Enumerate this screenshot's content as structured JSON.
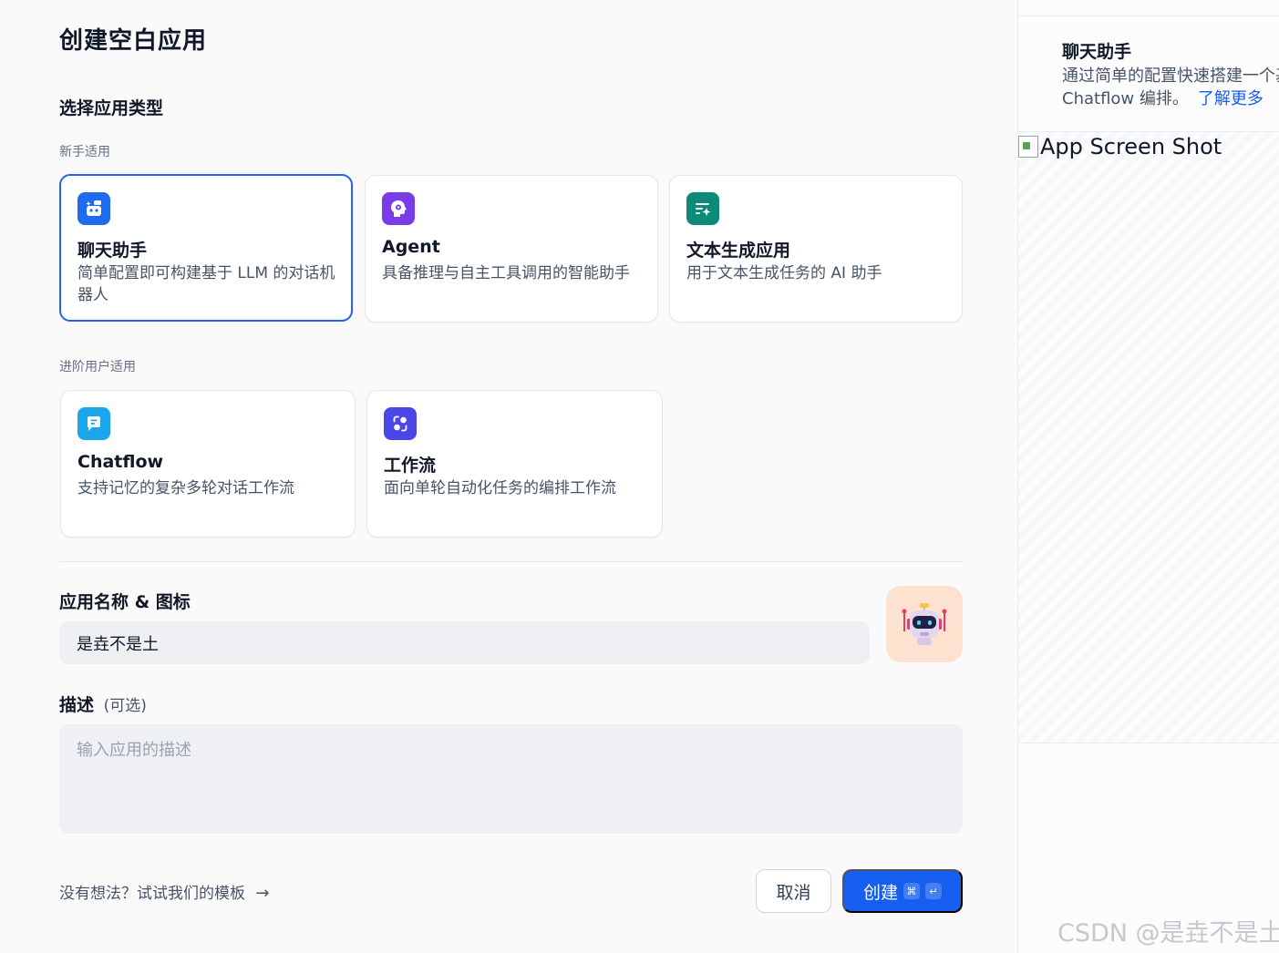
{
  "page": {
    "title": "创建空白应用"
  },
  "type_section": {
    "title": "选择应用类型",
    "beginner_label": "新手适用",
    "advanced_label": "进阶用户适用",
    "cards": [
      {
        "id": "chat-assistant",
        "title": "聊天助手",
        "desc": "简单配置即可构建基于 LLM 的对话机器人",
        "icon": "chat-bot-icon",
        "color": "#1d6cf0",
        "selected": true
      },
      {
        "id": "agent",
        "title": "Agent",
        "desc": "具备推理与自主工具调用的智能助手",
        "icon": "agent-brain-icon",
        "color": "#7a3be8",
        "selected": false
      },
      {
        "id": "text-generation",
        "title": "文本生成应用",
        "desc": "用于文本生成任务的 AI 助手",
        "icon": "text-sparkle-icon",
        "color": "#0e8a79",
        "selected": false
      },
      {
        "id": "chatflow",
        "title": "Chatflow",
        "desc": "支持记忆的复杂多轮对话工作流",
        "icon": "chatflow-icon",
        "color": "#1ba6ec",
        "selected": false
      },
      {
        "id": "workflow",
        "title": "工作流",
        "desc": "面向单轮自动化任务的编排工作流",
        "icon": "workflow-icon",
        "color": "#4b47e6",
        "selected": false
      }
    ]
  },
  "name_section": {
    "title": "应用名称 & 图标",
    "value": "是垚不是土",
    "avatar_icon": "robot-icon",
    "avatar_bg": "#fde3cf"
  },
  "desc_section": {
    "title": "描述",
    "optional": "(可选)",
    "placeholder": "输入应用的描述",
    "value": ""
  },
  "footer": {
    "template_link": "没有想法？试试我们的模板",
    "cancel": "取消",
    "create": "创建",
    "create_kbd_1": "⌘",
    "create_kbd_2": "↵"
  },
  "preview": {
    "title": "聊天助手",
    "desc_line1": "通过简单的配置快速搭建一个基",
    "desc_line2": "Chatflow 编排。",
    "learn_more": "了解更多",
    "image_alt": "App Screen Shot"
  },
  "watermark": "CSDN @是垚不是土",
  "colors": {
    "accent": "#155eef",
    "selected_border": "#2563eb"
  }
}
